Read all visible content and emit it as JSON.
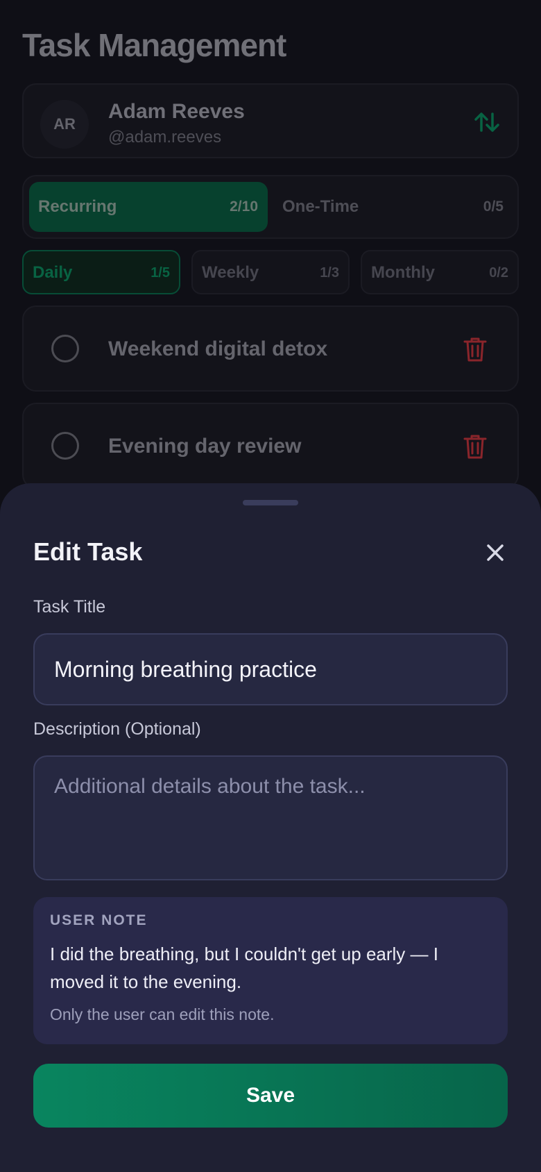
{
  "page": {
    "title": "Task Management"
  },
  "profile": {
    "initials": "AR",
    "name": "Adam Reeves",
    "handle": "@adam.reeves"
  },
  "segments": [
    {
      "label": "Recurring",
      "count": "2/10"
    },
    {
      "label": "One-Time",
      "count": "0/5"
    }
  ],
  "frequency": [
    {
      "label": "Daily",
      "count": "1/5"
    },
    {
      "label": "Weekly",
      "count": "1/3"
    },
    {
      "label": "Monthly",
      "count": "0/2"
    }
  ],
  "tasks": [
    {
      "title": "Weekend digital detox"
    },
    {
      "title": "Evening day review"
    }
  ],
  "sheet": {
    "title": "Edit Task",
    "title_label": "Task Title",
    "title_value": "Morning breathing practice",
    "desc_label": "Description (Optional)",
    "desc_placeholder": "Additional details about the task...",
    "note_heading": "USER NOTE",
    "note_body": "I did the breathing, but I couldn't get up early — I moved it to the evening.",
    "note_footer": "Only the user can edit this note.",
    "save_label": "Save"
  },
  "colors": {
    "accent": "#09855f",
    "danger": "#c0343c",
    "sheet_bg": "#1f2033"
  },
  "icons": {
    "sort": "sort-arrows-icon",
    "trash": "trash-icon",
    "close": "close-icon"
  }
}
